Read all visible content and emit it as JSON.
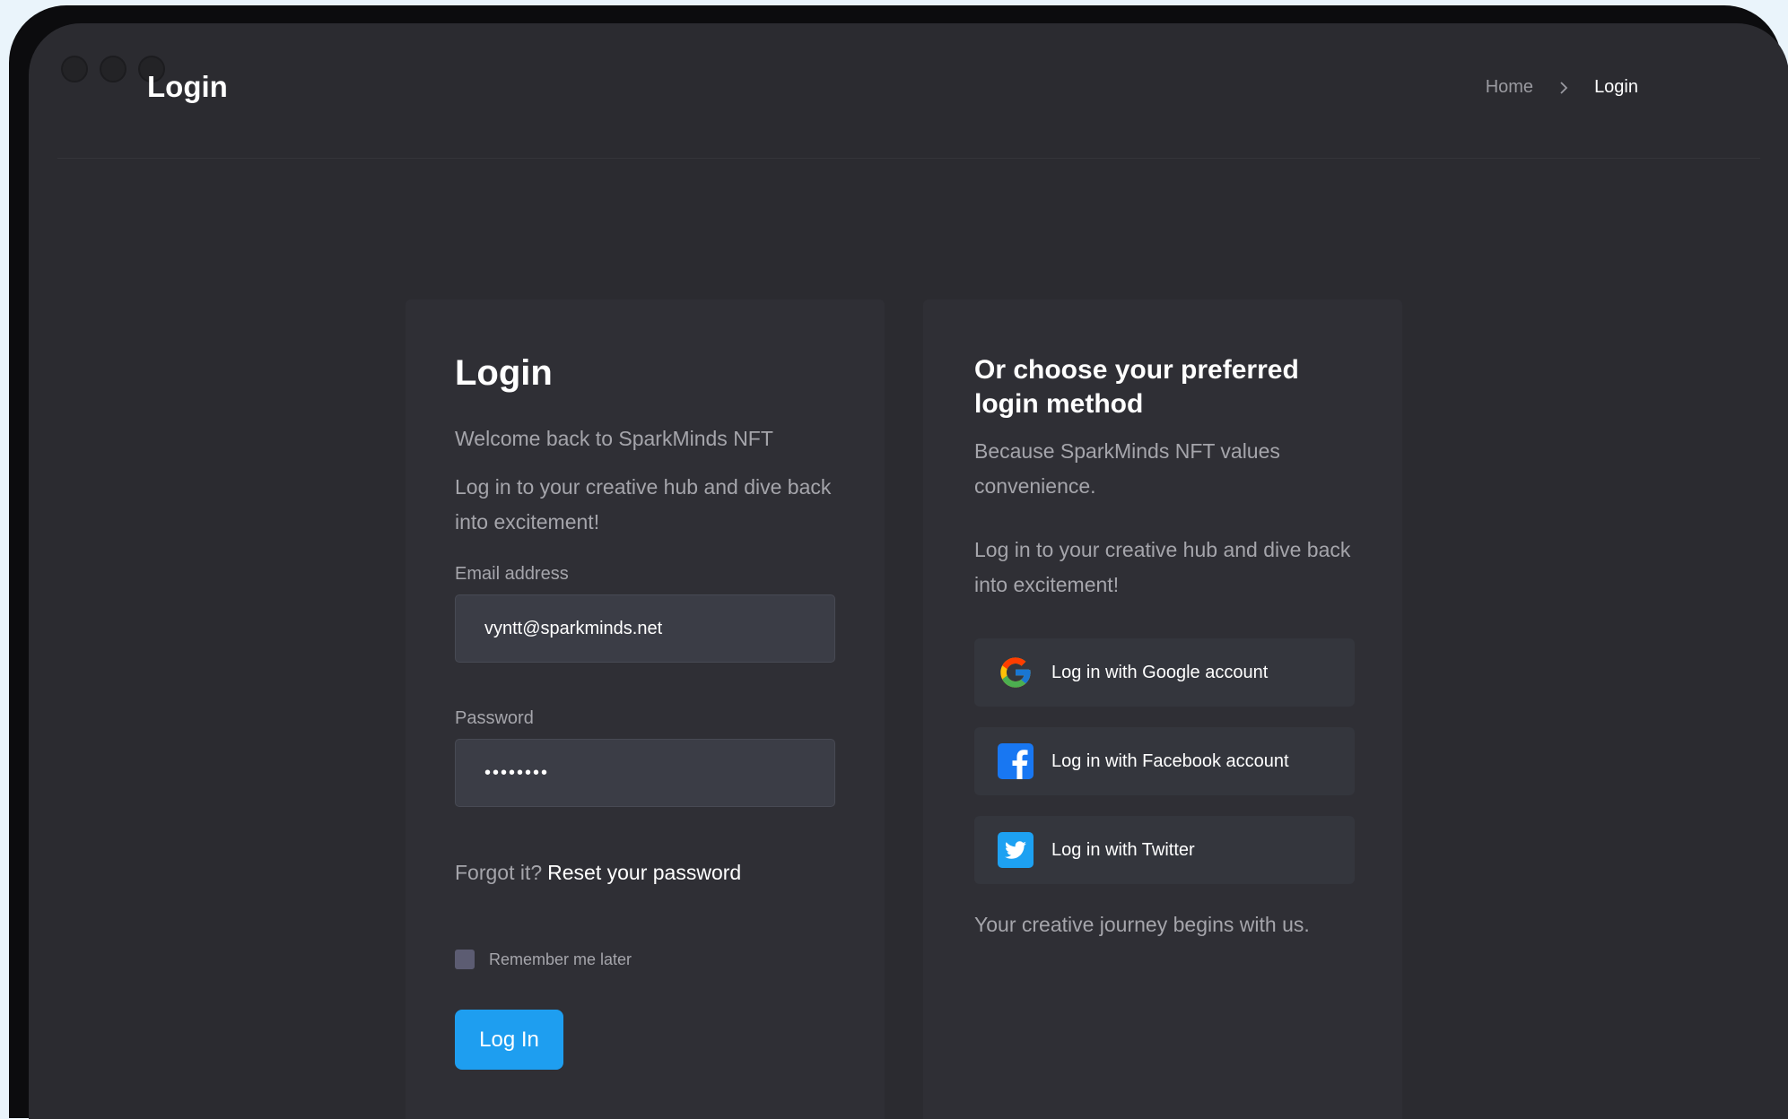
{
  "header": {
    "title": "Login",
    "breadcrumb": {
      "home": "Home",
      "current": "Login"
    }
  },
  "login_form": {
    "heading": "Login",
    "welcome": "Welcome back to SparkMinds NFT",
    "intro": "Log in to your creative hub and dive back into excitement!",
    "email_label": "Email address",
    "email_value": "vyntt@sparkminds.net",
    "password_label": "Password",
    "password_value": "••••••••",
    "forgot_text": "Forgot it?",
    "reset_link": "Reset your password",
    "remember_label": "Remember me later",
    "submit_label": "Log In"
  },
  "social": {
    "heading": "Or choose your preferred login method",
    "subtext": "Because SparkMinds NFT values convenience.",
    "intro": "Log in to your creative hub and dive back into excitement!",
    "buttons": [
      {
        "label": "Log in with Google account",
        "icon": "google-icon"
      },
      {
        "label": "Log in with Facebook account",
        "icon": "facebook-icon"
      },
      {
        "label": "Log in with Twitter",
        "icon": "twitter-icon"
      }
    ],
    "tagline": "Your creative journey begins with us."
  },
  "colors": {
    "background": "#2b2b30",
    "card": "#2f2f35",
    "input": "#3b3d46",
    "accent": "#1e9ef0",
    "facebook": "#1877f2",
    "twitter": "#1da1f2"
  }
}
